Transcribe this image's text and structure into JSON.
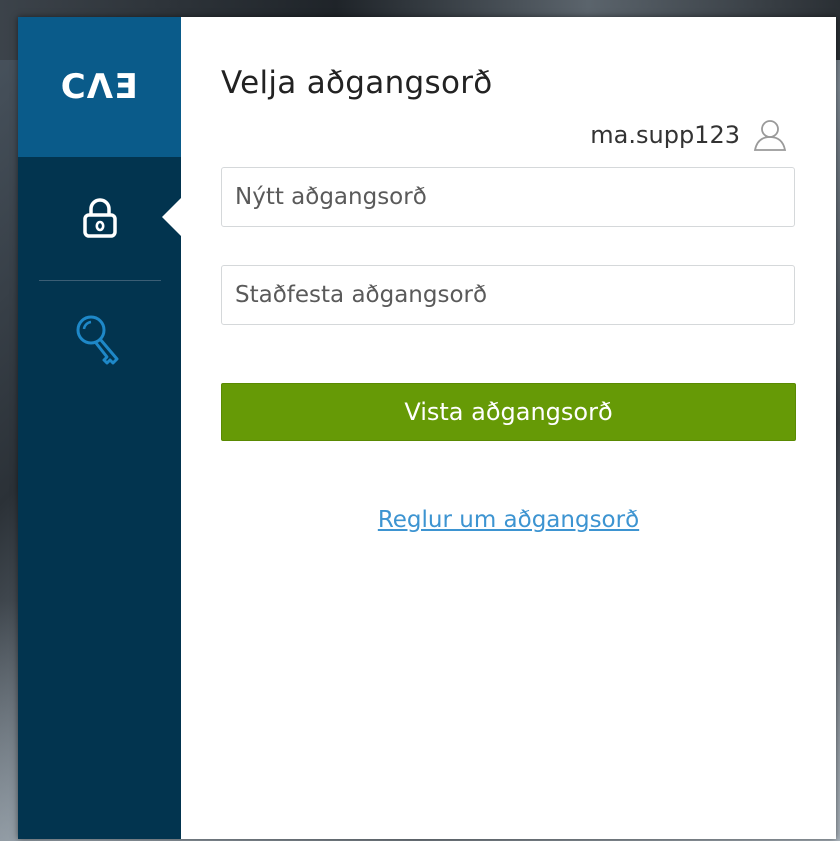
{
  "sidebar": {
    "logo": "CΛƎ",
    "items": [
      {
        "name": "lock-icon",
        "active": true
      },
      {
        "name": "key-icon",
        "active": false
      }
    ]
  },
  "main": {
    "title": "Velja aðgangsorð",
    "username": "ma.supp123",
    "new_password_placeholder": "Nýtt aðgangsorð",
    "confirm_password_placeholder": "Staðfesta aðgangsorð",
    "save_label": "Vista aðgangsorð",
    "rules_link": "Reglur um aðgangsorð"
  },
  "colors": {
    "sidebar": "#02344f",
    "logo_bg": "#0a5b8a",
    "button": "#669a06",
    "link": "#3d94d1"
  }
}
